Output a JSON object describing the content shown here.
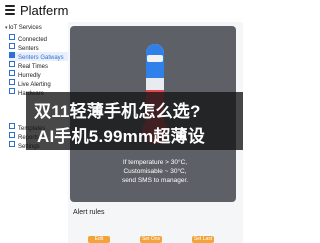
{
  "app": {
    "title": "Platferm"
  },
  "sidebar": {
    "section": "IoT Services",
    "items": [
      {
        "label": "Connected"
      },
      {
        "label": "Senters"
      },
      {
        "label": "Senters Gatways"
      },
      {
        "label": "Real Times"
      },
      {
        "label": "Hurredly"
      },
      {
        "label": "Live Alerting"
      },
      {
        "label": "Hardware"
      },
      {
        "label": "Templates"
      },
      {
        "label": "Reports"
      },
      {
        "label": "Settings"
      }
    ],
    "active_index": 2
  },
  "rule": {
    "line1": "If temperature > 30°C,",
    "line2": "Customisable ~ 30°C,",
    "line3": "send SMS to manager."
  },
  "gauge": {
    "blue_level": 0.42,
    "red_level": 0.44
  },
  "alert_rules": {
    "title": "Alert rules"
  },
  "actions": [
    {
      "label": "Edit"
    },
    {
      "label": "Set Ons"
    },
    {
      "label": "Set Last"
    }
  ],
  "banner": {
    "line1": "双11轻薄手机怎么选?",
    "line2": "AI手机5.99mm超薄设"
  },
  "colors": {
    "accent": "#2f6fd1",
    "card": "#5d6067",
    "gauge_blue": "#2f80e8",
    "gauge_red": "#e04a52",
    "button": "#f2a33a"
  }
}
